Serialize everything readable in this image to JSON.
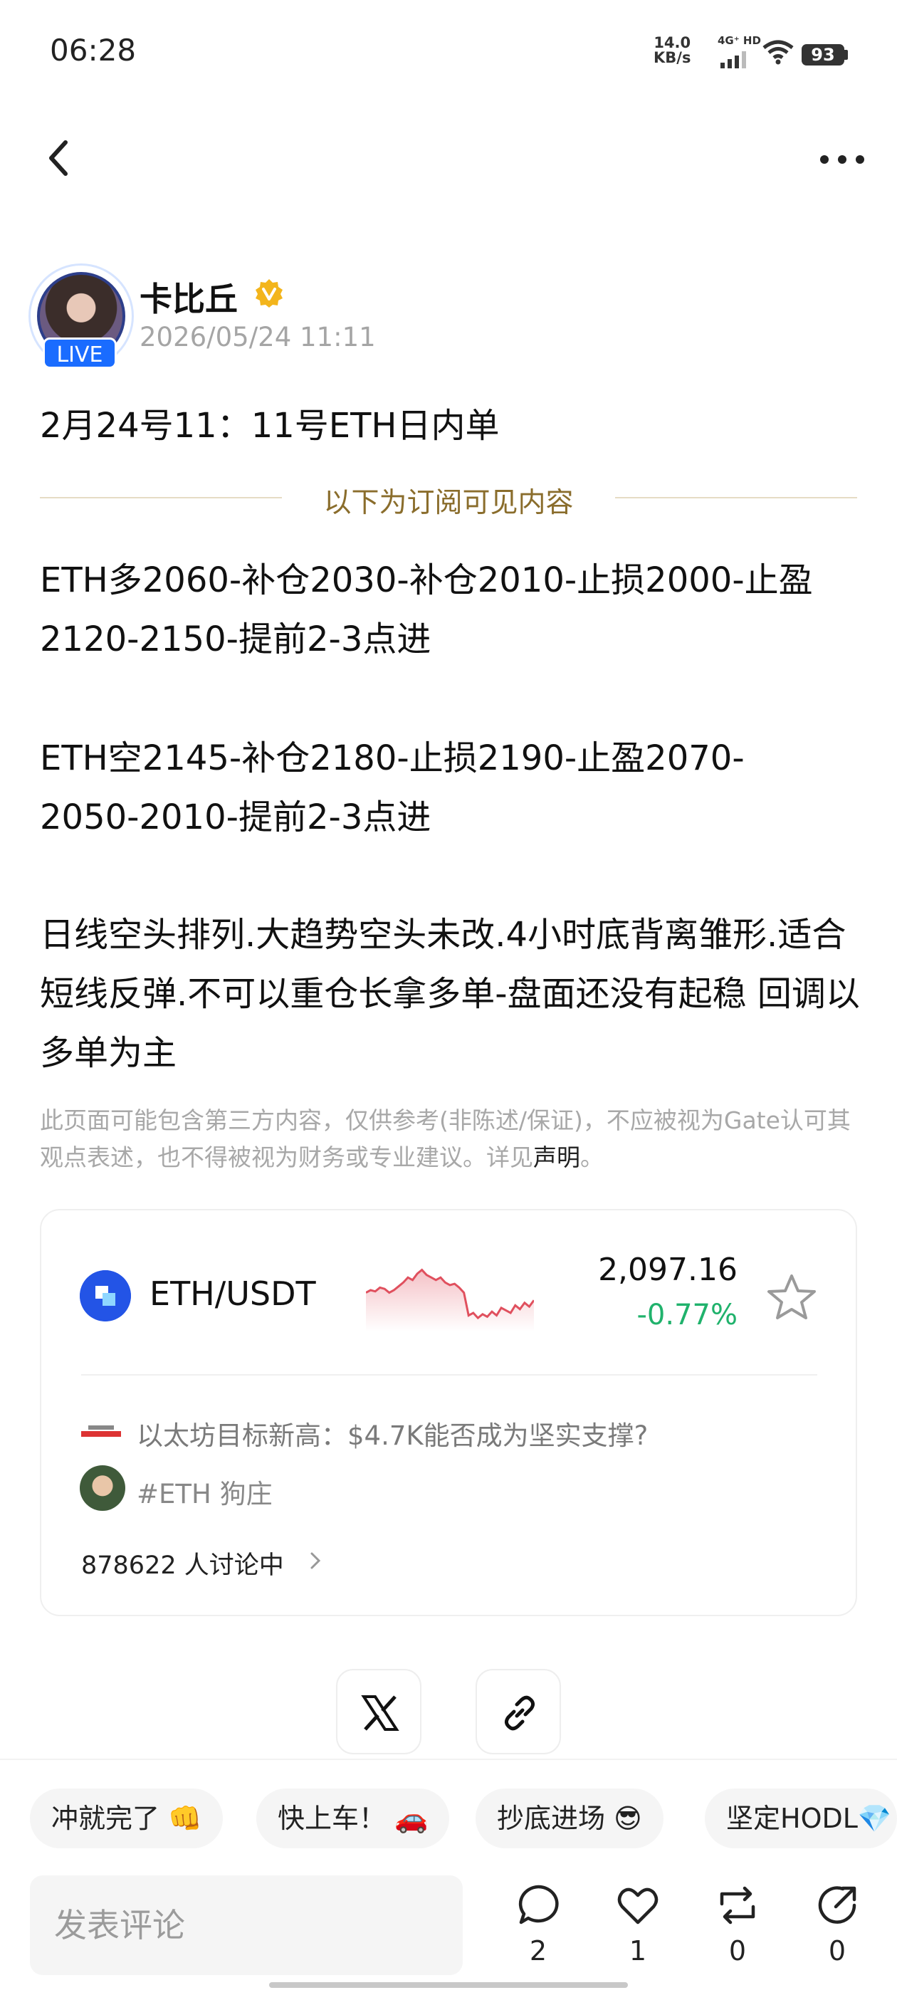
{
  "status_bar": {
    "time": "06:28",
    "net_speed_value": "14.0",
    "net_speed_unit": "KB/s",
    "network": "4G⁺ HD",
    "battery": "93"
  },
  "nav": {
    "back_icon": "chevron-left",
    "more_icon": "more-horizontal"
  },
  "author": {
    "name": "卡比丘",
    "badge": "LIVE",
    "verified_icon": "verified-badge",
    "timestamp": "2026/05/24 11:11"
  },
  "post": {
    "title": "2月24号11：11号ETH日内单",
    "subscribe_divider": "以下为订阅可见内容",
    "paragraphs": [
      "ETH多2060-补仓2030-补仓2010-止损2000-止盈2120-2150-提前2-3点进",
      "ETH空2145-补仓2180-止损2190-止盈2070-2050-2010-提前2-3点进",
      "日线空头排列.大趋势空头未改.4小时底背离雏形.适合短线反弹.不可以重仓长拿多单-盘面还没有起稳  回调以多单为主"
    ],
    "disclaimer": "此页面可能包含第三方内容，仅供参考(非陈述/保证)，不应被视为Gate认可其观点表述，也不得被视为财务或专业建议。详见",
    "disclaimer_link": "声明",
    "disclaimer_end": "。"
  },
  "market_card": {
    "pair": "ETH/USDT",
    "price": "2,097.16",
    "change": "-0.77%",
    "change_color": "#20b26c",
    "sparkline_color": "#e0505e",
    "sparkline": [
      40,
      42,
      41,
      44,
      43,
      40,
      42,
      45,
      48,
      52,
      50,
      55,
      58,
      54,
      52,
      50,
      52,
      48,
      46,
      47,
      44,
      40,
      22,
      24,
      20,
      23,
      21,
      25,
      22,
      28,
      26,
      24,
      30,
      27,
      32,
      29,
      34
    ],
    "news_title": "以太坊目标新高：$4.7K能否成为坚实支撑?",
    "tag": "#ETH 狗庄",
    "discussion": "878622 人讨论中"
  },
  "share": {
    "x_icon": "x-logo",
    "link_icon": "link"
  },
  "quick_replies": [
    "冲就完了 👊",
    "快上车！ 🚗",
    "抄底进场 😎",
    "坚定HODL💎"
  ],
  "comment_placeholder": "发表评论",
  "actions": [
    {
      "icon": "comment",
      "count": "2"
    },
    {
      "icon": "like",
      "count": "1"
    },
    {
      "icon": "repost",
      "count": "0"
    },
    {
      "icon": "share",
      "count": "0"
    }
  ]
}
